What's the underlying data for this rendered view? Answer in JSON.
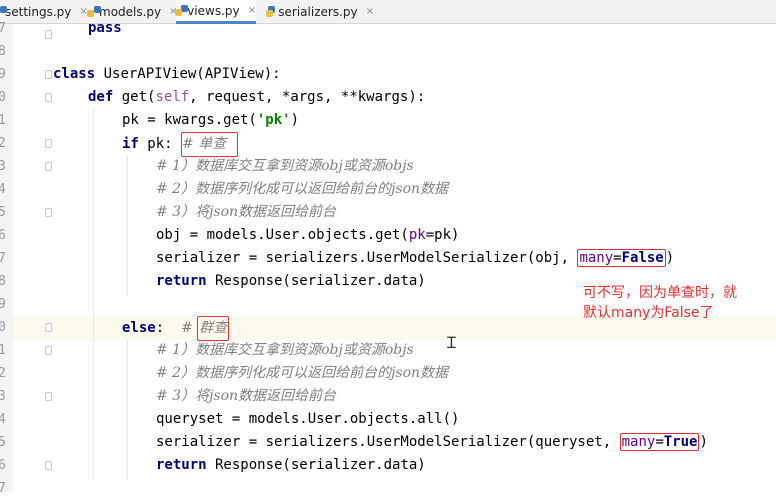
{
  "tabs": [
    {
      "label": "settings.py",
      "close": "×"
    },
    {
      "label": "models.py",
      "close": "×"
    },
    {
      "label": "views.py",
      "close": "×"
    },
    {
      "label": "serializers.py",
      "close": "×"
    }
  ],
  "line_numbers": [
    "7",
    "8",
    "9",
    "0",
    "1",
    "2",
    "3",
    "4",
    "5",
    "6",
    "7",
    "8",
    "9",
    "0",
    "1",
    "2",
    "3",
    "4",
    "5",
    "6",
    "7"
  ],
  "code": {
    "l7_kw": "pass",
    "l9_kw": "class",
    "l9_rest": " UserAPIView(APIView):",
    "l10_kw": "def",
    "l10_a": " get(",
    "l10_self": "self",
    "l10_b": ", request, *args, **kwargs):",
    "l11_a": "pk = kwargs.get(",
    "l11_str": "'pk'",
    "l11_b": ")",
    "l12_kw": "if",
    "l12_a": " pk: ",
    "l12_cm": "# 单查 ",
    "l13_cm": "# 1）数据库交互拿到资源obj或资源objs",
    "l14_cm": "# 2）数据序列化成可以返回给前台的json数据",
    "l15_cm": "# 3）将json数据返回给前台",
    "l16_a": "obj = models.User.objects.get(",
    "l16_kwarg": "pk",
    "l16_b": "=pk)",
    "l17_a": "serializer = serializers.UserModelSerializer(obj, ",
    "l17_kwarg": "many",
    "l17_eq": "=",
    "l17_const": "False",
    "l17_b": ")",
    "l18_kw": "return",
    "l18_rest": " Response(serializer.data)",
    "l20_kw": "else",
    "l20_a": ":  ",
    "l20_cm_hash": "# ",
    "l20_cm": "群查",
    "l21_cm": "# 1）数据库交互拿到资源obj或资源objs",
    "l22_cm": "# 2）数据序列化成可以返回给前台的json数据",
    "l23_cm": "# 3）将json数据返回给前台",
    "l24_a": "queryset = models.User.objects.all()",
    "l25_a": "serializer = serializers.UserModelSerializer(queryset, ",
    "l25_kwarg": "many",
    "l25_eq": "=",
    "l25_const": "True",
    "l25_b": ")",
    "l26_kw": "return",
    "l26_rest": " Response(serializer.data)"
  },
  "annotation": {
    "line1": "可不写，因为单查时，就",
    "line2": "默认many为False了"
  },
  "colors": {
    "keyword": "#000080",
    "string": "#008000",
    "comment": "#808080",
    "annotation": "#e53030",
    "active_tab_underline": "#4a88c7"
  }
}
